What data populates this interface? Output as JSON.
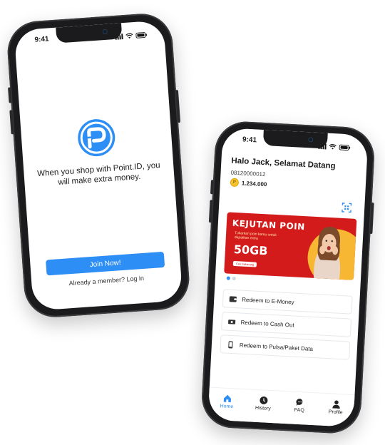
{
  "colors": {
    "accent": "#2d8ef5",
    "banner_red": "#d31b1b",
    "coin_gold": "#f7c331",
    "phone_frame": "#1b1b1d"
  },
  "welcome_screen": {
    "status_time": "9:41",
    "logo_icon": "point-id-logo-icon",
    "tagline": "When you shop with Point.ID, you will make extra money.",
    "join_button": "Join Now!",
    "login_prompt": "Already a member? Log in"
  },
  "home_screen": {
    "status_time": "9:41",
    "greeting": "Halo Jack, Selamat Datang",
    "phone_number": "08120000012",
    "points": "1.234.000",
    "scan_icon": "qr-scan-icon",
    "banner": {
      "title": "KEJUTAN POIN",
      "subtitle": "Tukarkan poin kamu untuk dapatkan extra",
      "big_text": "50GB",
      "cta": "Cek Sekarang"
    },
    "carousel_dots": 2,
    "carousel_active": 0,
    "menu": [
      {
        "label": "Redeem to E-Money",
        "icon": "wallet-icon"
      },
      {
        "label": "Redeem to Cash Out",
        "icon": "cash-icon"
      },
      {
        "label": "Redeem to Pulsa/Paket Data",
        "icon": "mobile-icon"
      }
    ],
    "tabs": [
      {
        "label": "Home",
        "icon": "home-icon",
        "active": true
      },
      {
        "label": "History",
        "icon": "clock-icon",
        "active": false
      },
      {
        "label": "FAQ",
        "icon": "chat-icon",
        "active": false
      },
      {
        "label": "Profile",
        "icon": "user-icon",
        "active": false
      }
    ]
  }
}
